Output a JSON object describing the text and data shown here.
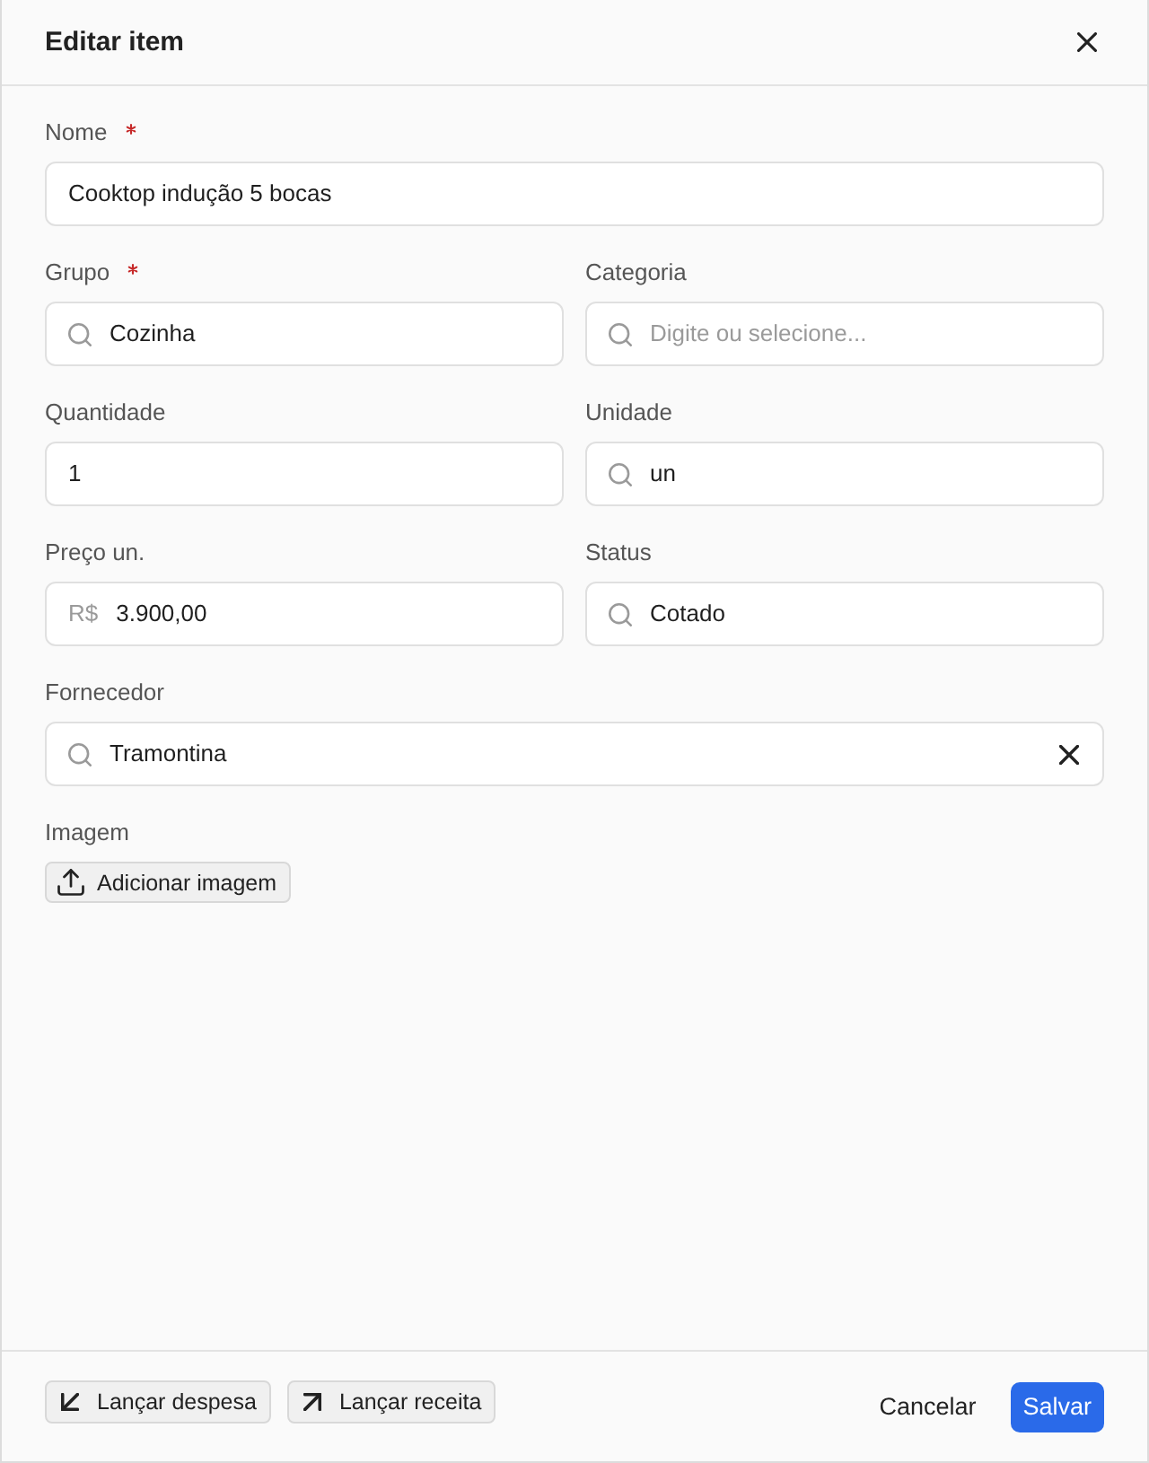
{
  "dialog": {
    "title": "Editar item"
  },
  "rows": [
    [
      {
        "label": "Nome",
        "required": true,
        "kind": "text",
        "value": "Cooktop indução 5 bocas",
        "clearable": false
      }
    ],
    [
      {
        "label": "Grupo",
        "required": true,
        "kind": "search",
        "value": "Cozinha",
        "clearable": false
      },
      {
        "label": "Categoria",
        "required": false,
        "kind": "search",
        "placeholder": "Digite ou selecione...",
        "clearable": false
      }
    ],
    [
      {
        "label": "Quantidade",
        "required": false,
        "kind": "text",
        "value": "1",
        "clearable": false
      },
      {
        "label": "Unidade",
        "required": false,
        "kind": "search",
        "value": "un",
        "clearable": false
      }
    ],
    [
      {
        "label": "Preço un.",
        "required": false,
        "kind": "currency",
        "prefix": "R$",
        "value": "3.900,00",
        "clearable": false
      },
      {
        "label": "Status",
        "required": false,
        "kind": "search",
        "value": "Cotado",
        "clearable": false
      }
    ],
    [
      {
        "label": "Fornecedor",
        "required": false,
        "kind": "search",
        "value": "Tramontina",
        "clearable": true
      }
    ],
    [
      {
        "label": "Imagem",
        "required": false,
        "kind": "upload",
        "button": "Adicionar imagem"
      }
    ]
  ],
  "footer": {
    "actions": [
      {
        "label": "Lançar despesa",
        "kind": "expense"
      },
      {
        "label": "Lançar receita",
        "kind": "income"
      }
    ],
    "buttons": [
      {
        "label": "Cancelar",
        "kind": "secondary"
      },
      {
        "label": "Salvar",
        "kind": "primary"
      }
    ]
  }
}
